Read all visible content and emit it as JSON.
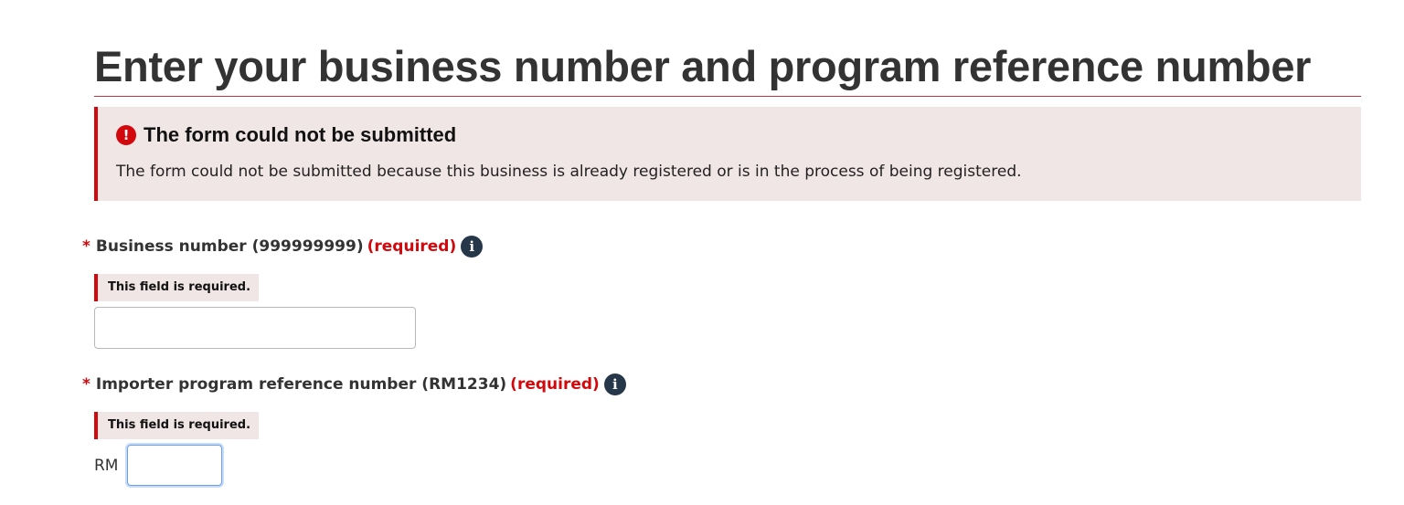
{
  "page": {
    "title": "Enter your business number and program reference number"
  },
  "error_summary": {
    "icon": "exclamation-circle-icon",
    "icon_glyph": "!",
    "heading": "The form could not be submitted",
    "message": "The form could not be submitted because this business is already registered or is in the process of being registered."
  },
  "fields": {
    "business_number": {
      "required_marker": "*",
      "label": "Business number (999999999)",
      "required_text": "(required)",
      "info_icon": "info-icon",
      "info_glyph": "i",
      "error": "This field is required.",
      "value": "",
      "placeholder": ""
    },
    "program_reference": {
      "required_marker": "*",
      "label": "Importer program reference number (RM1234)",
      "required_text": "(required)",
      "info_icon": "info-icon",
      "info_glyph": "i",
      "error": "This field is required.",
      "prefix": "RM",
      "value": "",
      "placeholder": ""
    }
  },
  "colors": {
    "error_red": "#d3080c",
    "title_rule": "#af3c43",
    "error_background": "#f1e6e6",
    "info_icon_background": "#26374a",
    "focus_border": "#6b9fe6"
  }
}
